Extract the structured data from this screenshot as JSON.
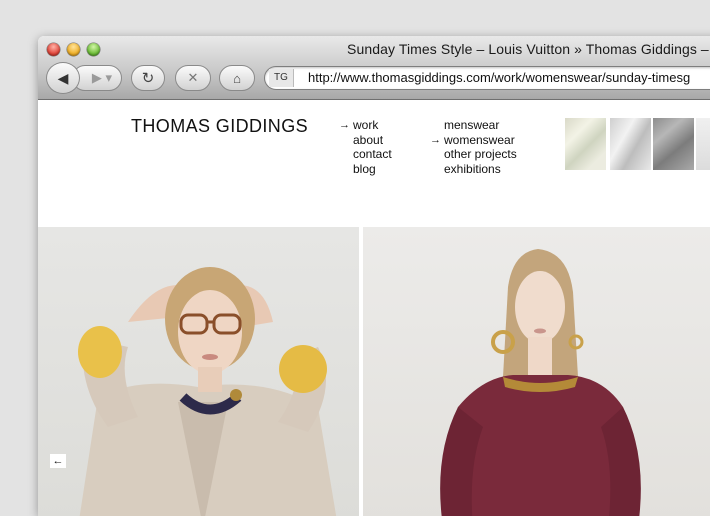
{
  "window": {
    "title": "Sunday Times Style – Louis Vuitton » Thomas Giddings – "
  },
  "toolbar": {
    "back_icon": "◀",
    "forward_icon": "▶ ▾",
    "reload_icon": "↻",
    "stop_icon": "✕",
    "home_icon": "⌂",
    "url": "http://www.thomasgiddings.com/work/womenswear/sunday-timesg",
    "favicon_text": "TG"
  },
  "site": {
    "title": "THOMAS GIDDINGS",
    "nav_primary": [
      {
        "label": "work",
        "active": true
      },
      {
        "label": "about",
        "active": false
      },
      {
        "label": "contact",
        "active": false
      },
      {
        "label": "blog",
        "active": false
      }
    ],
    "nav_secondary": [
      {
        "label": "menswear",
        "active": false
      },
      {
        "label": "womenswear",
        "active": true
      },
      {
        "label": "other projects",
        "active": false
      },
      {
        "label": "exhibitions",
        "active": false
      }
    ],
    "arrow_glyph": "→",
    "prev_arrow": "←"
  },
  "colors": {
    "accent_yellow": "#e9c14a",
    "blouse_burgundy": "#7a2a3b"
  }
}
